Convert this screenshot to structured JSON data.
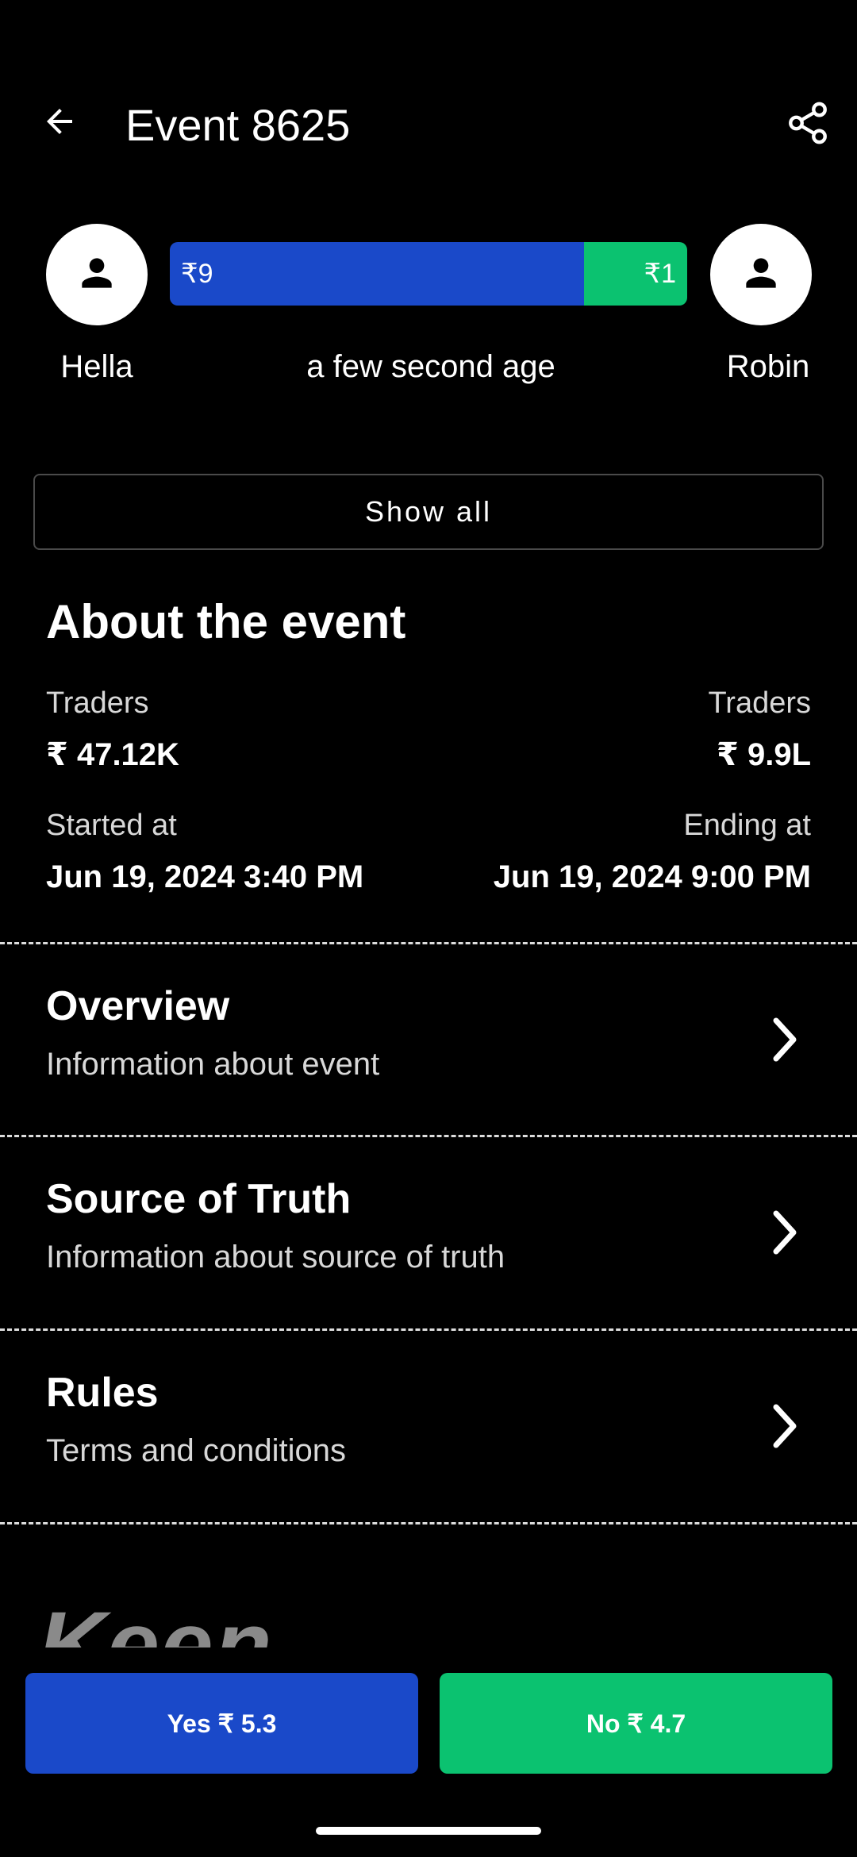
{
  "header": {
    "title": "Event 8625",
    "back_icon": "arrow-left-icon",
    "share_icon": "share-icon"
  },
  "versus": {
    "left_name": "Hella",
    "right_name": "Robin",
    "time_ago": "a few second age",
    "yes_amount": "₹9",
    "no_amount": "₹1",
    "yes_share": 0.8,
    "colors": {
      "yes": "#1A49C9",
      "no": "#0BC270"
    }
  },
  "show_all_label": "Show all",
  "about": {
    "title": "About the event",
    "left_traders_label": "Traders",
    "left_traders_value": "₹ 47.12K",
    "right_traders_label": "Traders",
    "right_traders_value": "₹ 9.9L",
    "started_label": "Started at",
    "started_value": "Jun 19, 2024 3:40 PM",
    "ending_label": "Ending at",
    "ending_value": "Jun 19, 2024 9:00 PM"
  },
  "sections": [
    {
      "title": "Overview",
      "subtitle": "Information about event"
    },
    {
      "title": "Source of Truth",
      "subtitle": "Information about source of truth"
    },
    {
      "title": "Rules",
      "subtitle": "Terms and conditions"
    }
  ],
  "brand_text": "Keen",
  "actions": {
    "yes_label": "Yes ₹ 5.3",
    "no_label": "No ₹ 4.7"
  }
}
